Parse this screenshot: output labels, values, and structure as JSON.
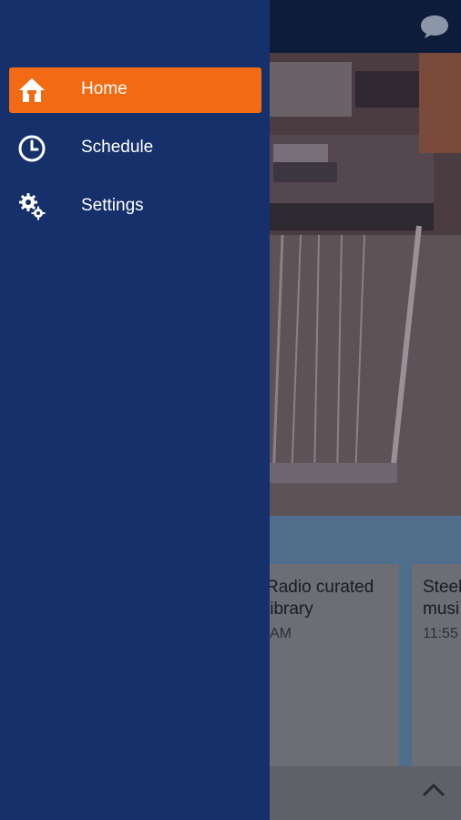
{
  "drawer": {
    "items": [
      {
        "label": "Home",
        "icon": "home-icon",
        "active": true
      },
      {
        "label": "Schedule",
        "icon": "clock-icon",
        "active": false
      },
      {
        "label": "Settings",
        "icon": "gears-icon",
        "active": false
      }
    ]
  },
  "feed": {
    "cards": [
      {
        "title": "Radio curated\n library",
        "time": "AM"
      },
      {
        "title": "Steel\nmusi",
        "time": "11:55"
      }
    ]
  },
  "colors": {
    "drawer_bg": "#16306b",
    "active_item": "#f26b14",
    "topbar": "#0e1c3c"
  }
}
